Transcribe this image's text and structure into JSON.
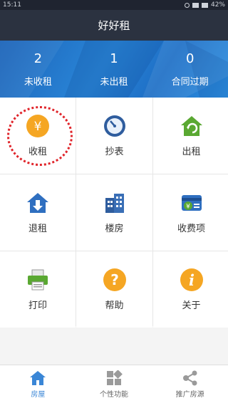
{
  "status_bar": {
    "time": "15:11",
    "battery": "42%"
  },
  "title": "好好租",
  "summary": [
    {
      "value": "2",
      "label": "未收租"
    },
    {
      "value": "1",
      "label": "未出租"
    },
    {
      "value": "0",
      "label": "合同过期"
    }
  ],
  "menu": [
    {
      "label": "收租",
      "icon": "yen-coin-icon"
    },
    {
      "label": "抄表",
      "icon": "meter-clock-icon"
    },
    {
      "label": "出租",
      "icon": "house-refresh-icon"
    },
    {
      "label": "退租",
      "icon": "house-down-arrow-icon"
    },
    {
      "label": "楼房",
      "icon": "building-icon"
    },
    {
      "label": "收费项",
      "icon": "yen-card-icon"
    },
    {
      "label": "打印",
      "icon": "printer-icon"
    },
    {
      "label": "帮助",
      "icon": "question-icon"
    },
    {
      "label": "关于",
      "icon": "info-icon"
    }
  ],
  "tabs": [
    {
      "label": "房屋",
      "icon": "house-tab-icon",
      "active": true
    },
    {
      "label": "个性功能",
      "icon": "grid-tab-icon",
      "active": false
    },
    {
      "label": "推广房源",
      "icon": "share-tab-icon",
      "active": false
    }
  ],
  "colors": {
    "titlebar": "#2b3240",
    "summary": "#2a86d8",
    "accent": "#3a86d6",
    "highlight": "#e0242a"
  }
}
